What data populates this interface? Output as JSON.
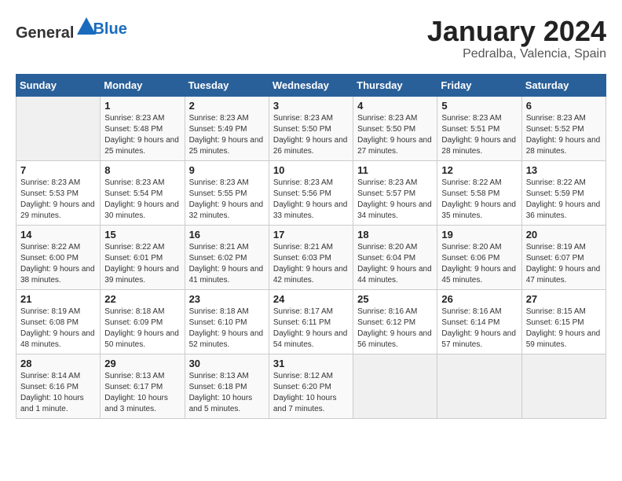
{
  "logo": {
    "general": "General",
    "blue": "Blue"
  },
  "title": "January 2024",
  "subtitle": "Pedralba, Valencia, Spain",
  "days_of_week": [
    "Sunday",
    "Monday",
    "Tuesday",
    "Wednesday",
    "Thursday",
    "Friday",
    "Saturday"
  ],
  "weeks": [
    [
      {
        "day": "",
        "sunrise": "",
        "sunset": "",
        "daylight": ""
      },
      {
        "day": "1",
        "sunrise": "Sunrise: 8:23 AM",
        "sunset": "Sunset: 5:48 PM",
        "daylight": "Daylight: 9 hours and 25 minutes."
      },
      {
        "day": "2",
        "sunrise": "Sunrise: 8:23 AM",
        "sunset": "Sunset: 5:49 PM",
        "daylight": "Daylight: 9 hours and 25 minutes."
      },
      {
        "day": "3",
        "sunrise": "Sunrise: 8:23 AM",
        "sunset": "Sunset: 5:50 PM",
        "daylight": "Daylight: 9 hours and 26 minutes."
      },
      {
        "day": "4",
        "sunrise": "Sunrise: 8:23 AM",
        "sunset": "Sunset: 5:50 PM",
        "daylight": "Daylight: 9 hours and 27 minutes."
      },
      {
        "day": "5",
        "sunrise": "Sunrise: 8:23 AM",
        "sunset": "Sunset: 5:51 PM",
        "daylight": "Daylight: 9 hours and 28 minutes."
      },
      {
        "day": "6",
        "sunrise": "Sunrise: 8:23 AM",
        "sunset": "Sunset: 5:52 PM",
        "daylight": "Daylight: 9 hours and 28 minutes."
      }
    ],
    [
      {
        "day": "7",
        "sunrise": "Sunrise: 8:23 AM",
        "sunset": "Sunset: 5:53 PM",
        "daylight": "Daylight: 9 hours and 29 minutes."
      },
      {
        "day": "8",
        "sunrise": "Sunrise: 8:23 AM",
        "sunset": "Sunset: 5:54 PM",
        "daylight": "Daylight: 9 hours and 30 minutes."
      },
      {
        "day": "9",
        "sunrise": "Sunrise: 8:23 AM",
        "sunset": "Sunset: 5:55 PM",
        "daylight": "Daylight: 9 hours and 32 minutes."
      },
      {
        "day": "10",
        "sunrise": "Sunrise: 8:23 AM",
        "sunset": "Sunset: 5:56 PM",
        "daylight": "Daylight: 9 hours and 33 minutes."
      },
      {
        "day": "11",
        "sunrise": "Sunrise: 8:23 AM",
        "sunset": "Sunset: 5:57 PM",
        "daylight": "Daylight: 9 hours and 34 minutes."
      },
      {
        "day": "12",
        "sunrise": "Sunrise: 8:22 AM",
        "sunset": "Sunset: 5:58 PM",
        "daylight": "Daylight: 9 hours and 35 minutes."
      },
      {
        "day": "13",
        "sunrise": "Sunrise: 8:22 AM",
        "sunset": "Sunset: 5:59 PM",
        "daylight": "Daylight: 9 hours and 36 minutes."
      }
    ],
    [
      {
        "day": "14",
        "sunrise": "Sunrise: 8:22 AM",
        "sunset": "Sunset: 6:00 PM",
        "daylight": "Daylight: 9 hours and 38 minutes."
      },
      {
        "day": "15",
        "sunrise": "Sunrise: 8:22 AM",
        "sunset": "Sunset: 6:01 PM",
        "daylight": "Daylight: 9 hours and 39 minutes."
      },
      {
        "day": "16",
        "sunrise": "Sunrise: 8:21 AM",
        "sunset": "Sunset: 6:02 PM",
        "daylight": "Daylight: 9 hours and 41 minutes."
      },
      {
        "day": "17",
        "sunrise": "Sunrise: 8:21 AM",
        "sunset": "Sunset: 6:03 PM",
        "daylight": "Daylight: 9 hours and 42 minutes."
      },
      {
        "day": "18",
        "sunrise": "Sunrise: 8:20 AM",
        "sunset": "Sunset: 6:04 PM",
        "daylight": "Daylight: 9 hours and 44 minutes."
      },
      {
        "day": "19",
        "sunrise": "Sunrise: 8:20 AM",
        "sunset": "Sunset: 6:06 PM",
        "daylight": "Daylight: 9 hours and 45 minutes."
      },
      {
        "day": "20",
        "sunrise": "Sunrise: 8:19 AM",
        "sunset": "Sunset: 6:07 PM",
        "daylight": "Daylight: 9 hours and 47 minutes."
      }
    ],
    [
      {
        "day": "21",
        "sunrise": "Sunrise: 8:19 AM",
        "sunset": "Sunset: 6:08 PM",
        "daylight": "Daylight: 9 hours and 48 minutes."
      },
      {
        "day": "22",
        "sunrise": "Sunrise: 8:18 AM",
        "sunset": "Sunset: 6:09 PM",
        "daylight": "Daylight: 9 hours and 50 minutes."
      },
      {
        "day": "23",
        "sunrise": "Sunrise: 8:18 AM",
        "sunset": "Sunset: 6:10 PM",
        "daylight": "Daylight: 9 hours and 52 minutes."
      },
      {
        "day": "24",
        "sunrise": "Sunrise: 8:17 AM",
        "sunset": "Sunset: 6:11 PM",
        "daylight": "Daylight: 9 hours and 54 minutes."
      },
      {
        "day": "25",
        "sunrise": "Sunrise: 8:16 AM",
        "sunset": "Sunset: 6:12 PM",
        "daylight": "Daylight: 9 hours and 56 minutes."
      },
      {
        "day": "26",
        "sunrise": "Sunrise: 8:16 AM",
        "sunset": "Sunset: 6:14 PM",
        "daylight": "Daylight: 9 hours and 57 minutes."
      },
      {
        "day": "27",
        "sunrise": "Sunrise: 8:15 AM",
        "sunset": "Sunset: 6:15 PM",
        "daylight": "Daylight: 9 hours and 59 minutes."
      }
    ],
    [
      {
        "day": "28",
        "sunrise": "Sunrise: 8:14 AM",
        "sunset": "Sunset: 6:16 PM",
        "daylight": "Daylight: 10 hours and 1 minute."
      },
      {
        "day": "29",
        "sunrise": "Sunrise: 8:13 AM",
        "sunset": "Sunset: 6:17 PM",
        "daylight": "Daylight: 10 hours and 3 minutes."
      },
      {
        "day": "30",
        "sunrise": "Sunrise: 8:13 AM",
        "sunset": "Sunset: 6:18 PM",
        "daylight": "Daylight: 10 hours and 5 minutes."
      },
      {
        "day": "31",
        "sunrise": "Sunrise: 8:12 AM",
        "sunset": "Sunset: 6:20 PM",
        "daylight": "Daylight: 10 hours and 7 minutes."
      },
      {
        "day": "",
        "sunrise": "",
        "sunset": "",
        "daylight": ""
      },
      {
        "day": "",
        "sunrise": "",
        "sunset": "",
        "daylight": ""
      },
      {
        "day": "",
        "sunrise": "",
        "sunset": "",
        "daylight": ""
      }
    ]
  ]
}
